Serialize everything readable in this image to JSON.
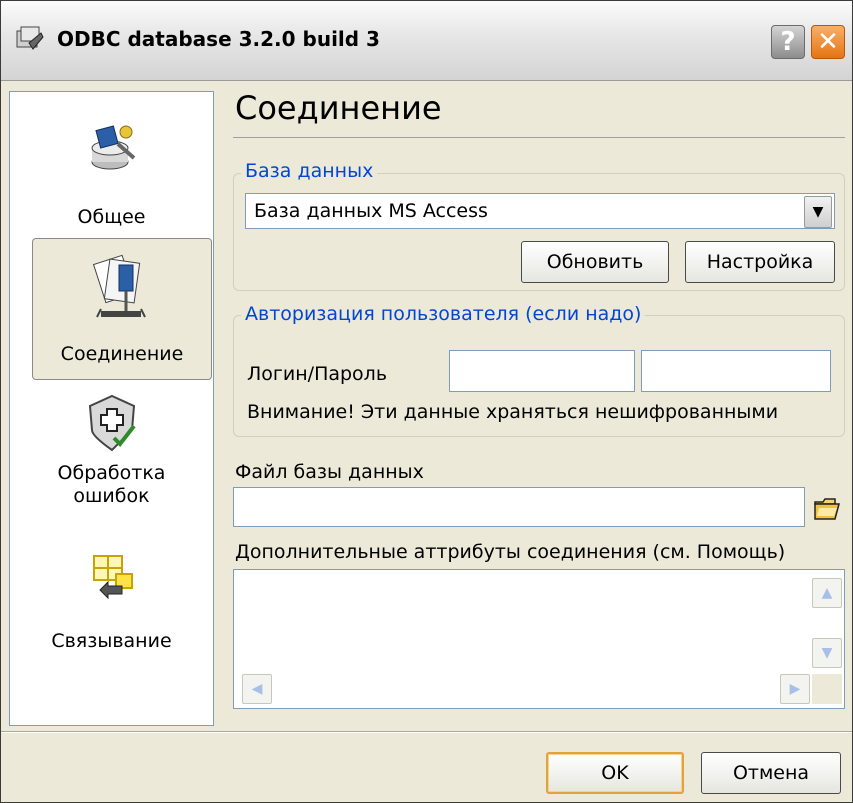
{
  "window": {
    "title": "ODBC database 3.2.0 build 3",
    "help_label": "?",
    "close_label": "✕"
  },
  "sidebar": {
    "items": [
      {
        "label": "Общее",
        "icon": "general-icon",
        "selected": false
      },
      {
        "label": "Соединение",
        "icon": "connection-icon",
        "selected": true
      },
      {
        "label": "Обработка\nошибок",
        "icon": "error-handling-icon",
        "selected": false
      },
      {
        "label": "Связывание",
        "icon": "binding-icon",
        "selected": false
      }
    ]
  },
  "main": {
    "page_title": "Соединение",
    "database_group": {
      "label": "База данных",
      "selected": "База данных MS Access",
      "refresh_label": "Обновить",
      "settings_label": "Настройка"
    },
    "auth_group": {
      "label": "Авторизация пользователя (если надо)",
      "login_label": "Логин/Пароль",
      "login_value": "",
      "password_value": "",
      "warning": "Внимание! Эти данные храняться нешифрованными"
    },
    "db_file": {
      "label": "Файл базы данных",
      "value": ""
    },
    "extra_attrs": {
      "label": "Дополнительные аттрибуты соединения (см. Помощь)",
      "value": ""
    }
  },
  "footer": {
    "ok_label": "OK",
    "cancel_label": "Отмена"
  },
  "colors": {
    "window_bg": "#ece9d8",
    "group_label": "#0046d5",
    "ok_border": "#e3a33a"
  }
}
